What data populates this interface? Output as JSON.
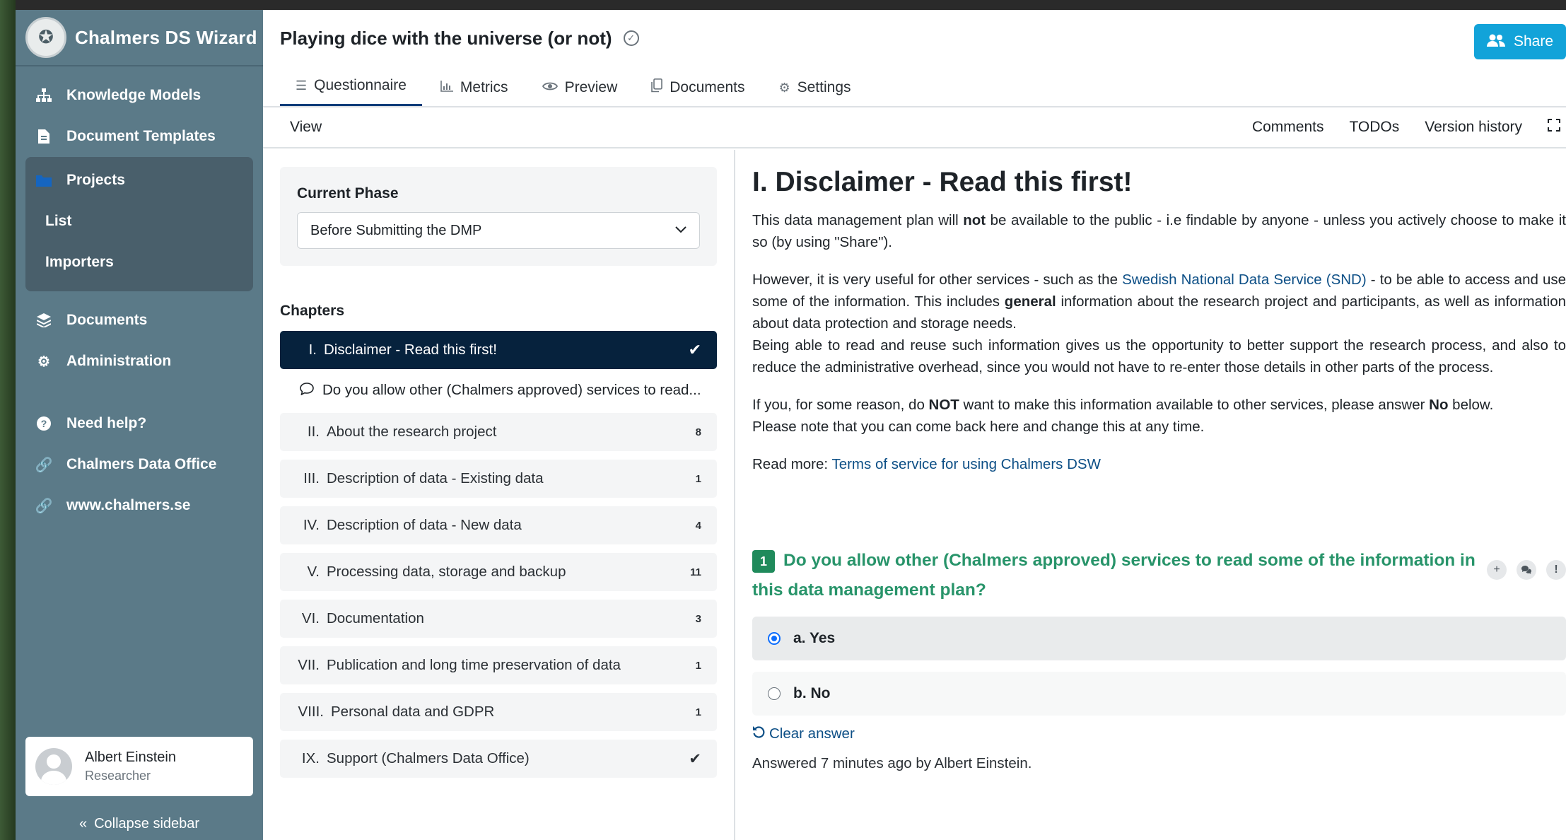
{
  "app": {
    "brand": "Chalmers DS Wizard"
  },
  "sidebar": {
    "items": [
      {
        "label": "Knowledge Models",
        "icon": "sitemap-icon"
      },
      {
        "label": "Document Templates",
        "icon": "file-icon"
      },
      {
        "label": "Projects",
        "icon": "folder-icon"
      },
      {
        "label": "Documents",
        "icon": "layers-icon"
      },
      {
        "label": "Administration",
        "icon": "gear-icon"
      },
      {
        "label": "Need help?",
        "icon": "help-icon"
      },
      {
        "label": "Chalmers Data Office",
        "icon": "link-icon"
      },
      {
        "label": "www.chalmers.se",
        "icon": "link-icon"
      }
    ],
    "projects_sub": [
      {
        "label": "List"
      },
      {
        "label": "Importers"
      }
    ],
    "user": {
      "name": "Albert Einstein",
      "role": "Researcher"
    },
    "collapse_label": "Collapse sidebar"
  },
  "header": {
    "title": "Playing dice with the universe (or not)",
    "share_label": "Share"
  },
  "tabs": [
    {
      "label": "Questionnaire",
      "icon": "list-icon",
      "active": true
    },
    {
      "label": "Metrics",
      "icon": "chart-icon"
    },
    {
      "label": "Preview",
      "icon": "eye-icon"
    },
    {
      "label": "Documents",
      "icon": "copy-icon"
    },
    {
      "label": "Settings",
      "icon": "gears-icon"
    }
  ],
  "toolbar": {
    "view": "View",
    "comments": "Comments",
    "todos": "TODOs",
    "version_history": "Version history"
  },
  "phase": {
    "label": "Current Phase",
    "value": "Before Submitting the DMP"
  },
  "chapters": {
    "label": "Chapters",
    "active": {
      "num": "I.",
      "label": "Disclaimer - Read this first!"
    },
    "active_question": "Do you allow other (Chalmers approved) services to read...",
    "items": [
      {
        "num": "II.",
        "label": "About the research project",
        "count": "8"
      },
      {
        "num": "III.",
        "label": "Description of data - Existing data",
        "count": "1"
      },
      {
        "num": "IV.",
        "label": "Description of data - New data",
        "count": "4"
      },
      {
        "num": "V.",
        "label": "Processing data, storage and backup",
        "count": "11"
      },
      {
        "num": "VI.",
        "label": "Documentation",
        "count": "3"
      },
      {
        "num": "VII.",
        "label": "Publication and long time preservation of data",
        "count": "1"
      },
      {
        "num": "VIII.",
        "label": "Personal data and GDPR",
        "count": "1"
      },
      {
        "num": "IX.",
        "label": "Support (Chalmers Data Office)",
        "count": ""
      }
    ]
  },
  "content": {
    "heading": "I. Disclaimer - Read this first!",
    "p1_a": "This data management plan will ",
    "p1_b": "not",
    "p1_c": " be available to the public - i.e findable by anyone - unless you actively choose to make it so (by using \"Share\").",
    "p2_a": "However, it is very useful for other services - such as the ",
    "p2_link": "Swedish National Data Service (SND)",
    "p2_b": " - to be able to access and use some of the information. This includes ",
    "p2_bold": "general",
    "p2_c": " information about the research project and participants, as well as information about data protection and storage needs.",
    "p2_d": "Being able to read and reuse such information gives us the opportunity to better support the research process, and also to reduce the administrative overhead, since you would not have to re-enter those details in other parts of the process.",
    "p3_a": "If you, for some reason, do ",
    "p3_bold": "NOT",
    "p3_b": " want to make this information available to other services, please answer ",
    "p3_bold2": "No",
    "p3_c": " below.",
    "p3_d": "Please note that you can come back here and change this at any time.",
    "p4_a": "Read more: ",
    "p4_link": "Terms of service for using Chalmers DSW"
  },
  "question": {
    "number": "1",
    "text": "Do you allow other (Chalmers approved) services to read some of the information in this data management plan?",
    "options": [
      {
        "label": "a. Yes",
        "selected": true
      },
      {
        "label": "b. No",
        "selected": false
      }
    ],
    "clear_label": "Clear answer",
    "answered": "Answered 7 minutes ago by Albert Einstein."
  },
  "colors": {
    "sidebar": "#5b7a88",
    "accent": "#12a3d9",
    "question": "#28946a",
    "active_chapter": "#06223d"
  }
}
